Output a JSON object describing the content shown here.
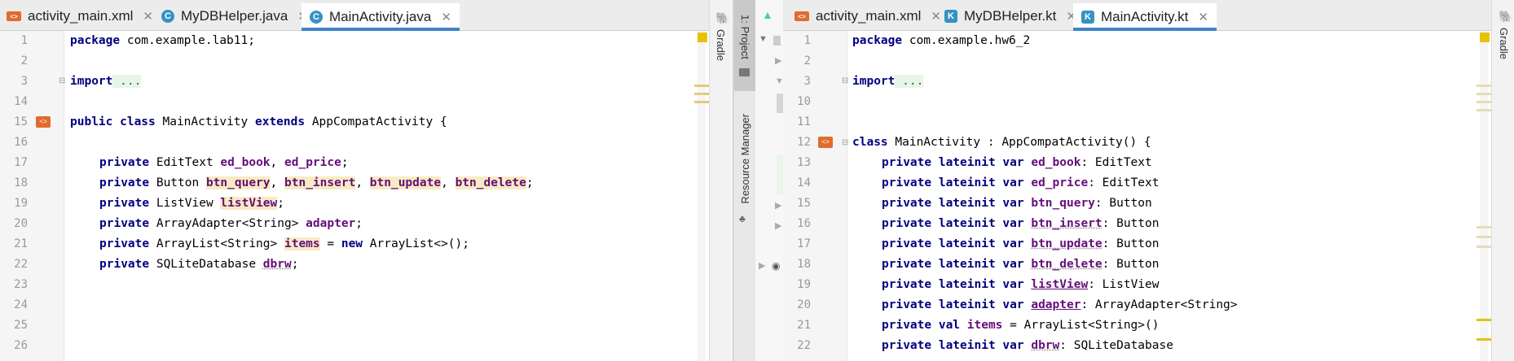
{
  "left": {
    "tabs": [
      {
        "label": "activity_main.xml",
        "icon": "xml-file-icon",
        "active": false
      },
      {
        "label": "MyDBHelper.java",
        "icon": "java-class-icon",
        "active": false
      },
      {
        "label": "MainActivity.java",
        "icon": "java-class-icon",
        "active": true
      }
    ],
    "line_numbers": [
      "1",
      "2",
      "3",
      "14",
      "15",
      "16",
      "17",
      "18",
      "19",
      "20",
      "21",
      "22",
      "23",
      "24",
      "25",
      "26"
    ],
    "code": {
      "l1_kw": "package",
      "l1_rest": " com.example.lab11;",
      "l3_kw": "import",
      "l3_fold": " ...",
      "l15_kw1": "public class",
      "l15_mid": " MainActivity ",
      "l15_kw2": "extends",
      "l15_rest": " AppCompatActivity {",
      "private": "private",
      "l17_type": " EditText ",
      "l17_f1": "ed_book",
      "l17_sep": ", ",
      "l17_f2": "ed_price",
      "l17_end": ";",
      "l18_type": " Button ",
      "l18_f1": "btn_query",
      "l18_sep1": ", ",
      "l18_f2": "btn_insert",
      "l18_sep2": ", ",
      "l18_f3": "btn_update",
      "l18_sep3": ", ",
      "l18_f4": "btn_delete",
      "l18_end": ";",
      "l19_type": " ListView ",
      "l19_f1": "listView",
      "l19_end": ";",
      "l20_type": " ArrayAdapter<String> ",
      "l20_f1": "adapter",
      "l20_end": ";",
      "l21_type": " ArrayList<String> ",
      "l21_f1": "items",
      "l21_mid": " = ",
      "l21_kw": "new",
      "l21_end": " ArrayList<>();",
      "l22_type": " SQLiteDatabase ",
      "l22_f1": "dbrw",
      "l22_end": ";"
    },
    "side_label": "Gradle"
  },
  "right": {
    "tabs": [
      {
        "label": "activity_main.xml",
        "icon": "xml-file-icon",
        "active": false
      },
      {
        "label": "MyDBHelper.kt",
        "icon": "kotlin-class-icon",
        "active": false
      },
      {
        "label": "MainActivity.kt",
        "icon": "kotlin-class-icon",
        "active": true
      }
    ],
    "line_numbers": [
      "1",
      "2",
      "3",
      "10",
      "11",
      "12",
      "13",
      "14",
      "15",
      "16",
      "17",
      "18",
      "19",
      "20",
      "21",
      "22"
    ],
    "code": {
      "l1_kw": "package",
      "l1_rest": " com.example.hw6_2",
      "l3_kw": "import",
      "l3_fold": " ...",
      "l12_kw": "class",
      "l12_rest": " MainActivity : AppCompatActivity() {",
      "plv": "private lateinit var",
      "pv": "private val",
      "l13_f": "ed_book",
      "l13_t": ": EditText",
      "l14_f": "ed_price",
      "l14_t": ": EditText",
      "l15_f": "btn_query",
      "l15_t": ": Button",
      "l16_f": "btn_insert",
      "l16_t": ": Button",
      "l17_f": "btn_update",
      "l17_t": ": Button",
      "l18_f": "btn_delete",
      "l18_t": ": Button",
      "l19_f": "listView",
      "l19_t": ": ListView",
      "l20_f": "adapter",
      "l20_t": ": ArrayAdapter<String>",
      "l21_f": "items",
      "l21_t": " = ArrayList<String>()",
      "l22_f": "dbrw",
      "l22_t": ": SQLiteDatabase"
    },
    "project_label": "1: Project",
    "resource_label": "Resource Manager",
    "side_label": "Gradle"
  },
  "colors": {
    "accent": "#4083c9",
    "keyword": "#000080",
    "field": "#660e7a",
    "highlight": "#f7ebc4"
  }
}
